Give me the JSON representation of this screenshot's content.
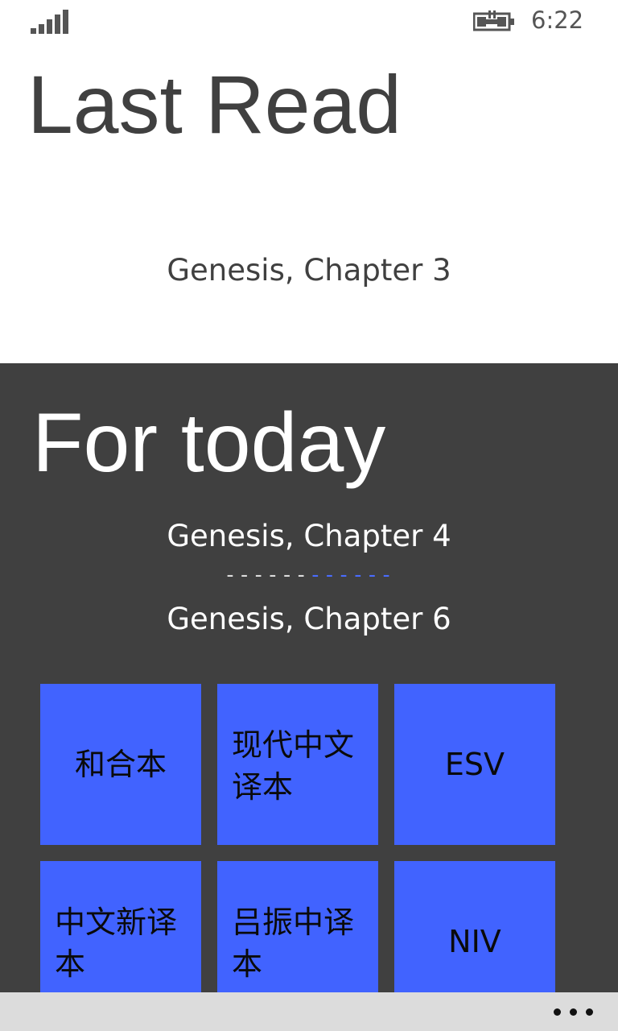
{
  "status_bar": {
    "time": "6:22",
    "signal_icon": "signal-strength-icon",
    "battery_icon": "battery-charging-icon"
  },
  "last_read": {
    "title": "Last Read",
    "chapter": "Genesis, Chapter 3"
  },
  "today": {
    "title": "For today",
    "from_chapter": "Genesis, Chapter 4",
    "divider_white": "------",
    "divider_blue": "------",
    "to_chapter": "Genesis, Chapter 6"
  },
  "versions": [
    {
      "label": "和合本"
    },
    {
      "label": "现代中文译本"
    },
    {
      "label": "ESV"
    },
    {
      "label": "中文新译本"
    },
    {
      "label": "吕振中译本"
    },
    {
      "label": "NIV"
    }
  ],
  "app_bar": {
    "more_icon": "more-options-icon"
  },
  "colors": {
    "tile": "#4163ff",
    "panel": "#404040",
    "app_bar": "#dcdcdc"
  }
}
